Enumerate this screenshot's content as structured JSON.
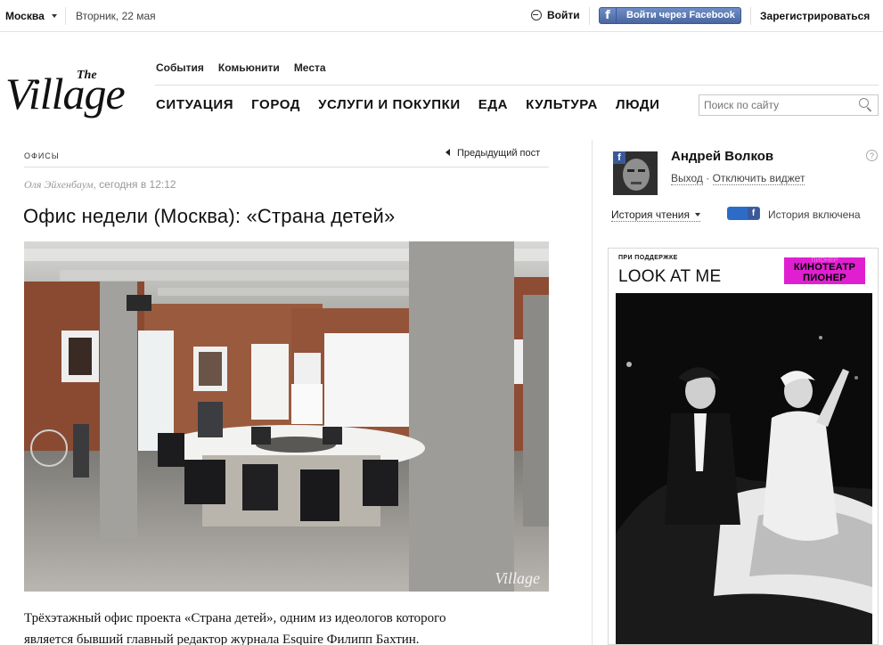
{
  "topbar": {
    "city": "Москва",
    "date": "Вторник, 22 мая",
    "login": "Войти",
    "facebook_login": "Войти через Facebook",
    "register": "Зарегистрироваться"
  },
  "header": {
    "logo_small": "The",
    "logo_big": "Village",
    "subnav": [
      "События",
      "Комьюнити",
      "Места"
    ],
    "mainnav": [
      "СИТУАЦИЯ",
      "ГОРОД",
      "УСЛУГИ И ПОКУПКИ",
      "ЕДА",
      "КУЛЬТУРА",
      "ЛЮДИ"
    ],
    "search_placeholder": "Поиск по сайту"
  },
  "article": {
    "rubric": "ОФИСЫ",
    "prev_post": "Предыдущий пост",
    "author": "Оля Эйхенбаум",
    "time": ", сегодня в 12:12",
    "title": "Офис недели (Москва): «Страна детей»",
    "watermark": "Village",
    "lead_line1": "Трёхэтажный офис проекта «Страна детей», одним из идеологов которого",
    "lead_line2": "является бывший главный редактор журнала Esquire Филипп Бахтин."
  },
  "sidebar": {
    "user_name": "Андрей Волков",
    "logout": "Выход",
    "separator": " · ",
    "disable_widget": "Отключить виджет",
    "help": "?",
    "history": "История чтения",
    "history_status": "История включена",
    "ad": {
      "support": "ПРИ ПОДДЕРЖКЕ",
      "brand": "LOOK AT ME",
      "kino_line1": "ПИОНЕР",
      "kino_line2": "КИНОТЕАТР",
      "kino_line3": "ПИОНЕР"
    }
  },
  "icons": {
    "facebook": "f",
    "login": "enter-icon",
    "search": "search-icon"
  },
  "colors": {
    "facebook_blue": "#3b5998",
    "toggle_blue": "#2d6bc9",
    "kino_magenta": "#e020d0"
  }
}
